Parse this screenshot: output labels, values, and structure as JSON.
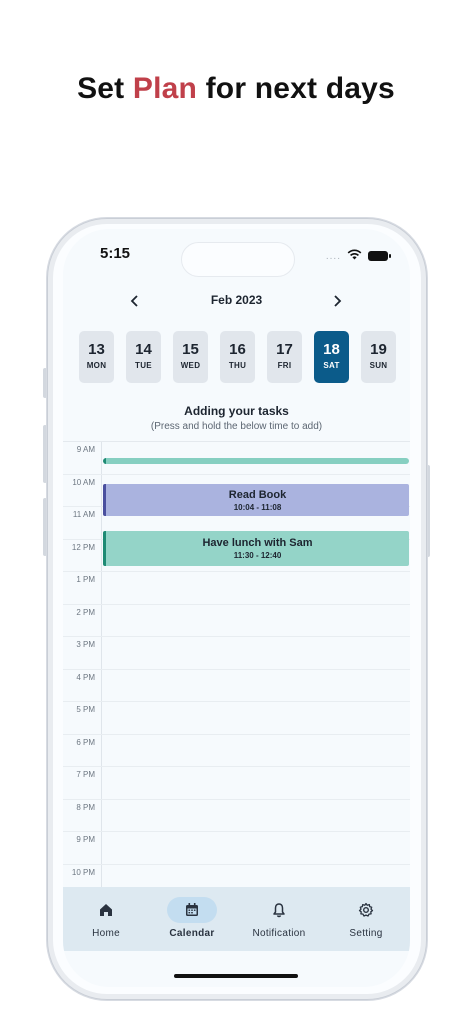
{
  "headline": {
    "prefix": "Set ",
    "accent": "Plan",
    "suffix": " for next days"
  },
  "status_bar": {
    "time": "5:15",
    "signal": "....",
    "icons": [
      "wifi-icon",
      "battery-icon"
    ]
  },
  "calendar": {
    "month_label": "Feb 2023",
    "days": [
      {
        "num": "13",
        "dow": "MON",
        "selected": false
      },
      {
        "num": "14",
        "dow": "TUE",
        "selected": false
      },
      {
        "num": "15",
        "dow": "WED",
        "selected": false
      },
      {
        "num": "16",
        "dow": "THU",
        "selected": false
      },
      {
        "num": "17",
        "dow": "FRI",
        "selected": false
      },
      {
        "num": "18",
        "dow": "SAT",
        "selected": true
      },
      {
        "num": "19",
        "dow": "SUN",
        "selected": false
      }
    ]
  },
  "hint": {
    "title": "Adding your tasks",
    "subtitle": "(Press and hold the below time to add)"
  },
  "timeline": {
    "hours": [
      "9 AM",
      "10 AM",
      "11 AM",
      "12 PM",
      "1 PM",
      "2 PM",
      "3 PM",
      "4 PM",
      "5 PM",
      "6 PM",
      "7 PM",
      "8 PM",
      "9 PM",
      "10 PM"
    ]
  },
  "events": [
    {
      "title": "",
      "time": "",
      "color": "#86cfc1",
      "accent": "#1e8a74"
    },
    {
      "title": "Read Book",
      "time": "10:04 - 11:08",
      "color": "#aab3df",
      "accent": "#4a4f9e"
    },
    {
      "title": "Have lunch with Sam",
      "time": "11:30 - 12:40",
      "color": "#94d4c8",
      "accent": "#1e8a74"
    }
  ],
  "nav": {
    "items": [
      {
        "label": "Home",
        "icon": "home-icon",
        "active": false
      },
      {
        "label": "Calendar",
        "icon": "calendar-icon",
        "active": true
      },
      {
        "label": "Notification",
        "icon": "bell-icon",
        "active": false
      },
      {
        "label": "Setting",
        "icon": "gear-icon",
        "active": false
      }
    ]
  },
  "colors": {
    "accent_red": "#c0404a",
    "selected_day": "#0b5b8a",
    "nav_bg": "#dde9f1",
    "nav_active": "#c3ddf0"
  }
}
